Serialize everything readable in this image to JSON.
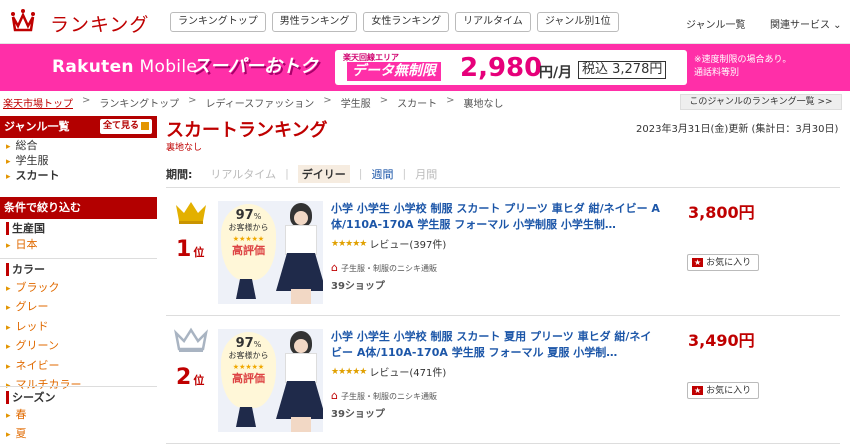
{
  "header": {
    "title": "ランキング",
    "tabs": [
      "ランキングトップ",
      "男性ランキング",
      "女性ランキング",
      "リアルタイム",
      "ジャンル別1位"
    ],
    "genre_list": "ジャンル一覧",
    "related": "関連サービス ⌄",
    "accent_color": "#bf0000"
  },
  "banner": {
    "brand": "Rakuten",
    "brand_suffix": " Mobile",
    "super": "スーパーおトク",
    "small": "楽天回線エリア",
    "unlimited": "データ無制限",
    "price": "2,980",
    "unit": "円/月",
    "tax": "税込 3,278円",
    "note1": "※速度制限の場合あり。",
    "note2": "通話料等別"
  },
  "breadcrumb": [
    "楽天市場トップ",
    "ランキングトップ",
    "レディースファッション",
    "学生服",
    "スカート",
    "裏地なし"
  ],
  "other_genre": "このジャンルのランキング一覧 >>",
  "sidebar": {
    "genre_head": "ジャンル一覧",
    "see_all": "全て見る",
    "genres": [
      "総合",
      "学生服",
      "スカート"
    ],
    "filter_head": "条件で絞り込む",
    "origin_title": "生産国",
    "origins": [
      "日本"
    ],
    "color_title": "カラー",
    "colors": [
      "ブラック",
      "グレー",
      "レッド",
      "グリーン",
      "ネイビー",
      "マルチカラー"
    ],
    "season_title": "シーズン",
    "seasons": [
      "春",
      "夏"
    ]
  },
  "main": {
    "title": "スカートランキング",
    "subtag": "裏地なし",
    "updated": "2023年3月31日(金)更新 (集計日：3月30日)",
    "period_label": "期間:",
    "periods": [
      "リアルタイム",
      "デイリー",
      "週間",
      "月間"
    ],
    "active_period": "デイリー"
  },
  "items": [
    {
      "rank": "1",
      "rank_suffix": "位",
      "title": "小学 小学生 小学校 制服 スカート プリーツ 車ヒダ 紺/ネイビー A体/110A-170A 学生服 フォーマル 小学制服 小学生制…",
      "review": "レビュー(397件)",
      "shop": "子生服・制服のニシキ通販",
      "points": "39ショップ",
      "price": "3,800円",
      "fav": "お気に入り",
      "badge_pct": "97",
      "badge_sub": "お客様から",
      "badge_high": "高評価",
      "crown_color": "#e3b000"
    },
    {
      "rank": "2",
      "rank_suffix": "位",
      "title": "小学 小学生 小学校 制服 スカート 夏用 プリーツ 車ヒダ 紺/ネイビー A体/110A-170A 学生服 フォーマル 夏服 小学制…",
      "review": "レビュー(471件)",
      "shop": "子生服・制服のニシキ通販",
      "points": "39ショップ",
      "price": "3,490円",
      "fav": "お気に入り",
      "badge_pct": "97",
      "badge_sub": "お客様から",
      "badge_high": "高評価",
      "crown_color": "#a9b4c2"
    }
  ]
}
